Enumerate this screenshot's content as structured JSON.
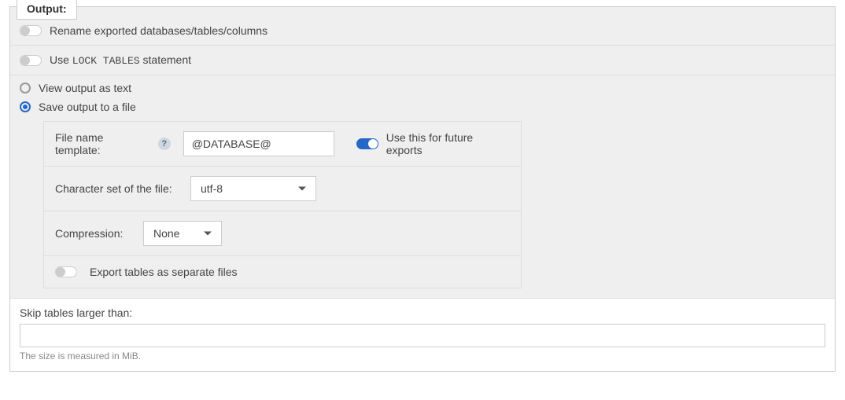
{
  "legend": "Output:",
  "toggles": {
    "rename": "Rename exported databases/tables/columns",
    "use_lock_pre": "Use ",
    "use_lock_code": "LOCK TABLES",
    "use_lock_post": " statement"
  },
  "radios": {
    "view_as_text": "View output as text",
    "save_to_file": "Save output to a file"
  },
  "file_panel": {
    "filename_label": "File name template:",
    "filename_value": "@DATABASE@",
    "future_exports": "Use this for future exports",
    "charset_label": "Character set of the file:",
    "charset_value": "utf-8",
    "compression_label": "Compression:",
    "compression_value": "None",
    "export_separate": "Export tables as separate files"
  },
  "skip": {
    "label": "Skip tables larger than:",
    "value": "",
    "hint": "The size is measured in MiB."
  }
}
